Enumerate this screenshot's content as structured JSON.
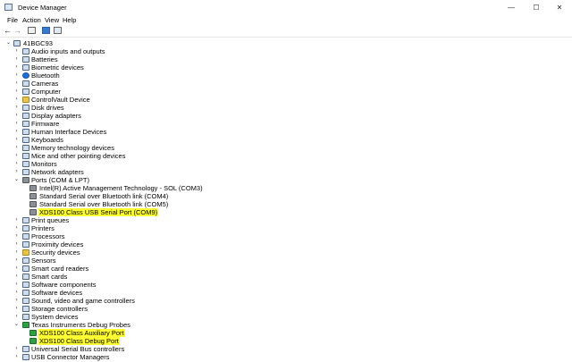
{
  "window": {
    "title": "Device Manager"
  },
  "window_controls": {
    "minimize": "—",
    "maximize": "☐",
    "close": "✕"
  },
  "menu": [
    "File",
    "Action",
    "View",
    "Help"
  ],
  "toolbar": {
    "back": "←",
    "forward": "→"
  },
  "tree": {
    "root": "41BGC93",
    "items": [
      {
        "label": "Audio inputs and outputs",
        "icon": "speaker-icon",
        "expanded": false
      },
      {
        "label": "Batteries",
        "icon": "battery-icon",
        "expanded": false
      },
      {
        "label": "Biometric devices",
        "icon": "fingerprint-icon",
        "expanded": false
      },
      {
        "label": "Bluetooth",
        "icon": "bluetooth-icon",
        "expanded": false
      },
      {
        "label": "Cameras",
        "icon": "camera-icon",
        "expanded": false
      },
      {
        "label": "Computer",
        "icon": "computer-icon",
        "expanded": false
      },
      {
        "label": "ControlVault Device",
        "icon": "vault-icon",
        "expanded": false
      },
      {
        "label": "Disk drives",
        "icon": "disk-icon",
        "expanded": false
      },
      {
        "label": "Display adapters",
        "icon": "display-adapter-icon",
        "expanded": false
      },
      {
        "label": "Firmware",
        "icon": "chip-icon",
        "expanded": false
      },
      {
        "label": "Human Interface Devices",
        "icon": "hid-icon",
        "expanded": false
      },
      {
        "label": "Keyboards",
        "icon": "keyboard-icon",
        "expanded": false
      },
      {
        "label": "Memory technology devices",
        "icon": "memory-icon",
        "expanded": false
      },
      {
        "label": "Mice and other pointing devices",
        "icon": "mouse-icon",
        "expanded": false
      },
      {
        "label": "Monitors",
        "icon": "monitor-icon",
        "expanded": false
      },
      {
        "label": "Network adapters",
        "icon": "network-icon",
        "expanded": false
      },
      {
        "label": "Ports (COM & LPT)",
        "icon": "port-icon",
        "expanded": true,
        "children": [
          {
            "label": "Intel(R) Active Management Technology - SOL (COM3)",
            "icon": "port-icon",
            "highlight": false
          },
          {
            "label": "Standard Serial over Bluetooth link (COM4)",
            "icon": "port-icon",
            "highlight": false
          },
          {
            "label": "Standard Serial over Bluetooth link (COM5)",
            "icon": "port-icon",
            "highlight": false
          },
          {
            "label": "XDS100 Class USB Serial Port (COM9)",
            "icon": "port-icon",
            "highlight": true
          }
        ]
      },
      {
        "label": "Print queues",
        "icon": "printer-icon",
        "expanded": false
      },
      {
        "label": "Printers",
        "icon": "printer-icon",
        "expanded": false
      },
      {
        "label": "Processors",
        "icon": "processor-icon",
        "expanded": false
      },
      {
        "label": "Proximity devices",
        "icon": "proximity-icon",
        "expanded": false
      },
      {
        "label": "Security devices",
        "icon": "security-icon",
        "expanded": false
      },
      {
        "label": "Sensors",
        "icon": "sensor-icon",
        "expanded": false
      },
      {
        "label": "Smart card readers",
        "icon": "smartcard-icon",
        "expanded": false
      },
      {
        "label": "Smart cards",
        "icon": "smartcard-icon",
        "expanded": false
      },
      {
        "label": "Software components",
        "icon": "software-icon",
        "expanded": false
      },
      {
        "label": "Software devices",
        "icon": "software-icon",
        "expanded": false
      },
      {
        "label": "Sound, video and game controllers",
        "icon": "sound-icon",
        "expanded": false
      },
      {
        "label": "Storage controllers",
        "icon": "storage-icon",
        "expanded": false
      },
      {
        "label": "System devices",
        "icon": "system-icon",
        "expanded": false
      },
      {
        "label": "Texas Instruments Debug Probes",
        "icon": "probe-icon",
        "expanded": true,
        "children": [
          {
            "label": "XDS100 Class Auxiliary Port",
            "icon": "usb-green-icon",
            "highlight": true
          },
          {
            "label": "XDS100 Class Debug Port",
            "icon": "usb-green-icon",
            "highlight": true
          }
        ]
      },
      {
        "label": "Universal Serial Bus controllers",
        "icon": "usb-icon",
        "expanded": false
      },
      {
        "label": "USB Connector Managers",
        "icon": "usb-icon",
        "expanded": false
      }
    ]
  },
  "colors": {
    "highlight": "#fdff32",
    "accent": "#1d6fd6"
  }
}
